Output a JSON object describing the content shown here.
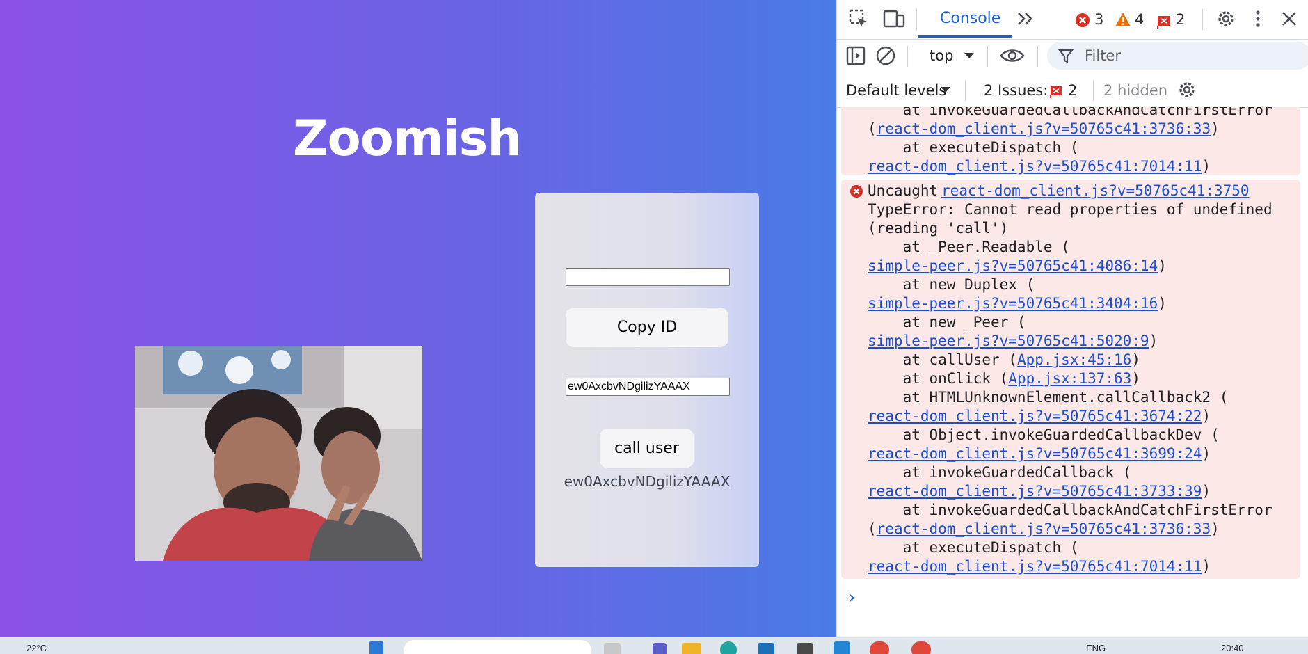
{
  "app": {
    "title": "Zoomish",
    "my_id_input_value": "",
    "copy_button_label": "Copy ID",
    "call_id_input_value": "ew0AxcbvNDgilizYAAAX",
    "call_button_label": "call user",
    "my_id_text": "ew0AxcbvNDgilizYAAAX"
  },
  "devtools": {
    "active_tab": "Console",
    "error_count": "3",
    "warning_count": "4",
    "issue_count_badge": "2",
    "context": "top",
    "filter_placeholder": "Filter",
    "levels": "Default levels",
    "issues_label": "2 Issues:",
    "issues_count": "2",
    "hidden_label": "2 hidden",
    "top_block": {
      "l1": "    at invokeGuardedCallbackAndCatchFirstError",
      "l2_pre": "(",
      "l2_link": "react-dom_client.js?v=50765c41:3736:33",
      "l2_post": ")",
      "l3": "    at executeDispatch (",
      "l4_link": "react-dom_client.js?v=50765c41:7014:11",
      "l4_post": ")"
    },
    "error": {
      "prefix": "Uncaught",
      "source_link": "react-dom_client.js?v=50765c41:3750",
      "msg1": "TypeError: Cannot read properties of undefined",
      "msg2": "(reading 'call')",
      "s1": "    at _Peer.Readable (",
      "s1_link": "simple-peer.js?v=50765c41:4086:14",
      "s2": "    at new Duplex (",
      "s2_link": "simple-peer.js?v=50765c41:3404:16",
      "s3": "    at new _Peer (",
      "s3_link": "simple-peer.js?v=50765c41:5020:9",
      "s4_pre": "    at callUser (",
      "s4_link": "App.jsx:45:16",
      "s5_pre": "    at onClick (",
      "s5_link": "App.jsx:137:63",
      "s6": "    at HTMLUnknownElement.callCallback2 (",
      "s6_link": "react-dom_client.js?v=50765c41:3674:22",
      "s7": "    at Object.invokeGuardedCallbackDev (",
      "s7_link": "react-dom_client.js?v=50765c41:3699:24",
      "s8": "    at invokeGuardedCallback (",
      "s8_link": "react-dom_client.js?v=50765c41:3733:39",
      "s9": "    at invokeGuardedCallbackAndCatchFirstError",
      "s10_link": "react-dom_client.js?v=50765c41:3736:33",
      "s11": "    at executeDispatch (",
      "s11_link": "react-dom_client.js?v=50765c41:7014:11",
      "close": ")",
      "open": "("
    },
    "prompt": "›"
  },
  "taskbar": {
    "weather": "22°C",
    "lang": "ENG",
    "time": "20:40"
  },
  "colors": {
    "accent": "#1a62d3",
    "error": "#d93025",
    "warning": "#e8710a",
    "link": "#1b4fcf",
    "error_bg": "#fce8e6"
  }
}
